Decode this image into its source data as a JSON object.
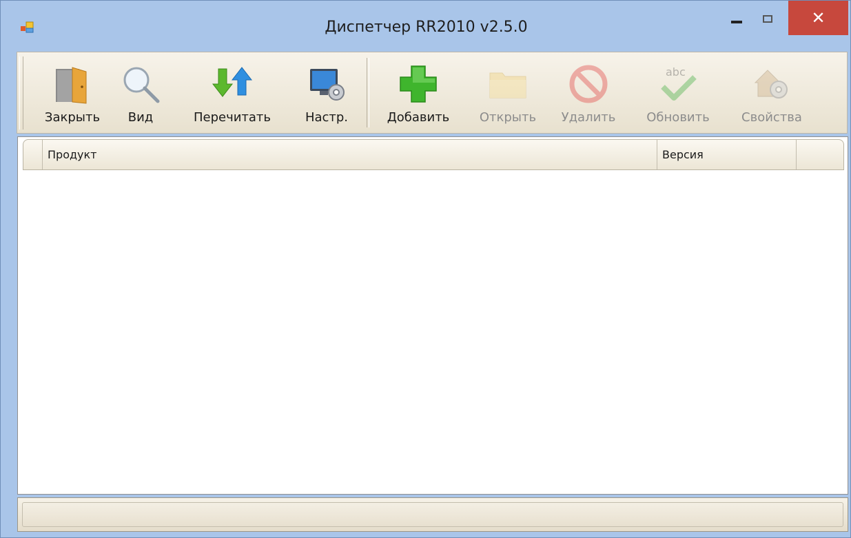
{
  "window": {
    "title": "Диспетчер RR2010 v2.5.0",
    "close_glyph": "✕",
    "accent": "#a9c5e9",
    "close_color": "#c7483d"
  },
  "toolbar": {
    "buttons": [
      {
        "label": "Закрыть",
        "icon": "door-icon",
        "enabled": true
      },
      {
        "label": "Вид",
        "icon": "magnifier-icon",
        "enabled": true
      },
      {
        "label": "Перечитать",
        "icon": "refresh-arrows-icon",
        "enabled": true
      },
      {
        "label": "Настр.",
        "icon": "monitor-gear-icon",
        "enabled": true
      },
      {
        "label": "Добавить",
        "icon": "green-plus-icon",
        "enabled": true
      },
      {
        "label": "Открыть",
        "icon": "folder-icon",
        "enabled": false
      },
      {
        "label": "Удалить",
        "icon": "no-entry-icon",
        "enabled": false
      },
      {
        "label": "Обновить",
        "icon": "abc-check-icon",
        "enabled": false
      },
      {
        "label": "Свойства",
        "icon": "house-gear-icon",
        "enabled": false
      }
    ]
  },
  "list": {
    "columns": [
      "",
      "Продукт",
      "Версия",
      ""
    ],
    "rows": []
  },
  "status": {
    "text": ""
  }
}
